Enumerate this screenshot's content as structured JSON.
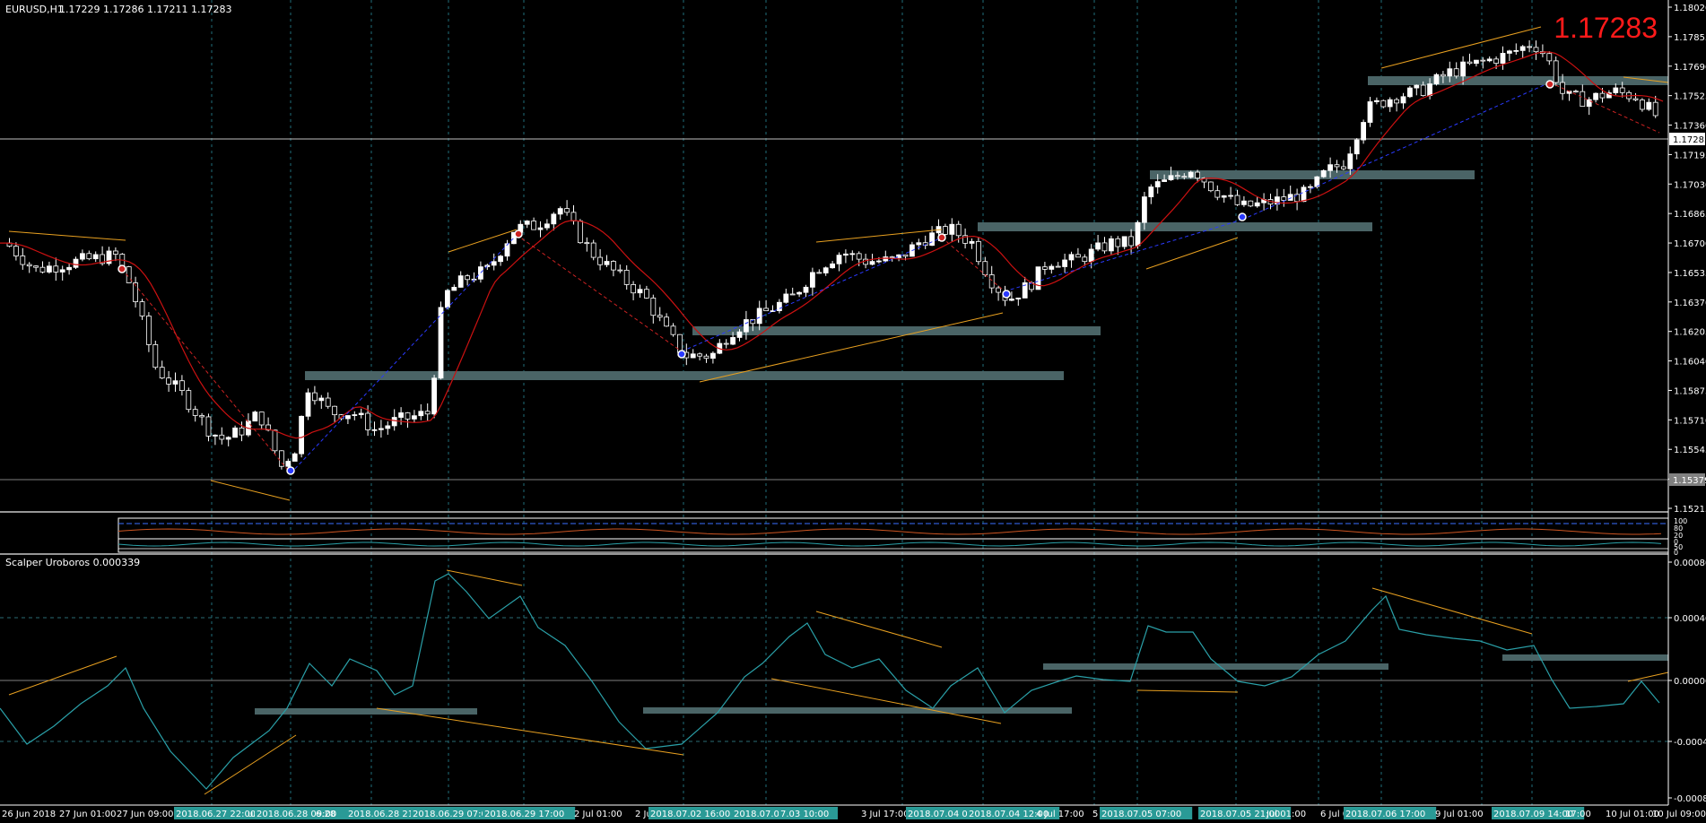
{
  "header": {
    "symbol": "EURUSD,H1",
    "ohlc": "1.17229 1.17286 1.17211 1.17283"
  },
  "big_price": "1.17283",
  "price_scale": {
    "labels": [
      "1.18020",
      "1.17855",
      "1.17690",
      "1.17525",
      "1.17360",
      "1.17195",
      "1.17030",
      "1.16865",
      "1.16700",
      "1.16535",
      "1.16370",
      "1.16205",
      "1.16040",
      "1.15875",
      "1.15710",
      "1.15545",
      "1.15379",
      "1.15215"
    ],
    "current_tag": "1.17283",
    "hline_tag": "1.15379"
  },
  "oscillator": {
    "title": "Scalper Uroboros 0.000339",
    "scale": [
      "0.000807",
      "0.00040",
      "0.00000",
      "-0.00040",
      "-0.000807"
    ]
  },
  "mini_panel": {
    "scale": [
      "100",
      "80",
      "20",
      "0",
      "50",
      "0"
    ]
  },
  "time_axis": {
    "labels": [
      {
        "text": "26 Jun 2018",
        "hl": false
      },
      {
        "text": "27 Jun 01:00",
        "hl": false
      },
      {
        "text": "27 Jun 09:00",
        "hl": false
      },
      {
        "text": "2018.06.27 22:00",
        "hl": true
      },
      {
        "text": "ur",
        "hl": false
      },
      {
        "text": "2018.06.28 09:00",
        "hl": true
      },
      {
        "text": "6.28",
        "hl": false
      },
      {
        "text": "2018.06.28 21:00",
        "hl": true
      },
      {
        "text": "2018.06.29 07:00",
        "hl": true
      },
      {
        "text": "2018.06.29 17:00",
        "hl": true
      },
      {
        "text": "2 Jul 01:00",
        "hl": false
      },
      {
        "text": "2 Ju",
        "hl": false
      },
      {
        "text": "2018.07.02 16:00",
        "hl": true
      },
      {
        "text": "2018.07.03 04:00",
        "hl": true
      },
      {
        "text": "7.03 10:00",
        "hl": true
      },
      {
        "text": "3 Jul 17:00",
        "hl": false
      },
      {
        "text": "2018.07.04 04",
        "hl": true
      },
      {
        "text": "2018.07.04 12:00",
        "hl": true
      },
      {
        "text": "4 Jul 17:00",
        "hl": false
      },
      {
        "text": "5",
        "hl": false
      },
      {
        "text": "2018.07.05 07:00",
        "hl": true
      },
      {
        "text": "2018.07.05 21:00",
        "hl": true
      },
      {
        "text": "Jul 01:00",
        "hl": false
      },
      {
        "text": "6 Jul 0",
        "hl": false
      },
      {
        "text": "2018.07.06 17:00",
        "hl": true
      },
      {
        "text": "9 Jul 01:00",
        "hl": false
      },
      {
        "text": "2018.07.09 14:00",
        "hl": true
      },
      {
        "text": "17:00",
        "hl": false
      },
      {
        "text": "10 Jul 01:00",
        "hl": false
      },
      {
        "text": "10 Jul 09:00",
        "hl": false
      }
    ]
  },
  "colors": {
    "background": "#000000",
    "bull": "#ffffff",
    "bear": "#000000",
    "ma": "#cc1111",
    "zone": "#4a6466",
    "trend": "#e8a020",
    "osc": "#2aa0a8",
    "grid": "#1f6e7a",
    "highlight_tag": "#2a9a96",
    "big_price": "#ff1a1a"
  }
}
